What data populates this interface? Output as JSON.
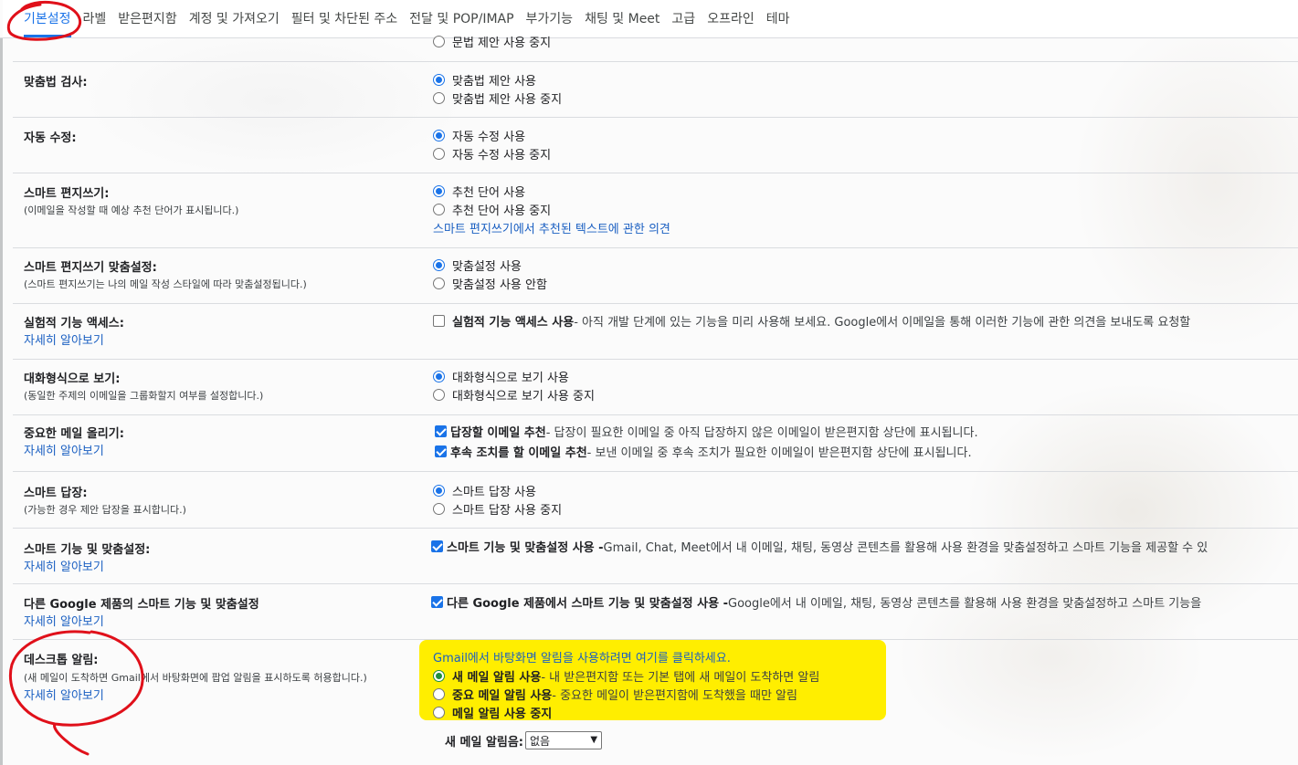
{
  "tabs": [
    "기본설정",
    "라벨",
    "받은편지함",
    "계정 및 가져오기",
    "필터 및 차단된 주소",
    "전달 및 POP/IMAP",
    "부가기능",
    "채팅 및 Meet",
    "고급",
    "오프라인",
    "테마"
  ],
  "top_partial": "문법 제안 사용 중지",
  "spelling": {
    "label": "맞춤법 검사:",
    "on": "맞춤법 제안 사용",
    "off": "맞춤법 제안 사용 중지"
  },
  "autocorrect": {
    "label": "자동 수정:",
    "on": "자동 수정 사용",
    "off": "자동 수정 사용 중지"
  },
  "smart_compose": {
    "label": "스마트 편지쓰기:",
    "sub": "(이메일을 작성할 때 예상 추천 단어가 표시됩니다.)",
    "on": "추천 단어 사용",
    "off": "추천 단어 사용 중지",
    "feedback": "스마트 편지쓰기에서 추천된 텍스트에 관한 의견"
  },
  "smart_compose_personal": {
    "label": "스마트 편지쓰기 맞춤설정:",
    "sub": "(스마트 편지쓰기는 나의 메일 작성 스타일에 따라 맞춤설정됩니다.)",
    "on": "맞춤설정 사용",
    "off": "맞춤설정 사용 안함"
  },
  "experimental": {
    "label": "실험적 기능 액세스:",
    "learn": "자세히 알아보기",
    "opt_bold": "실험적 기능 액세스 사용",
    "opt_desc": " - 아직 개발 단계에 있는 기능을 미리 사용해 보세요. Google에서 이메일을 통해 이러한 기능에 관한 의견을 보내도록 요청할"
  },
  "conversation": {
    "label": "대화형식으로 보기:",
    "sub": "(동일한 주제의 이메일을 그룹화할지 여부를 설정합니다.)",
    "on": "대화형식으로 보기 사용",
    "off": "대화형식으로 보기 사용 중지"
  },
  "nudges": {
    "label": "중요한 메일 올리기:",
    "learn": "자세히 알아보기",
    "opt1_bold": "답장할 이메일 추천",
    "opt1_desc": " - 답장이 필요한 이메일 중 아직 답장하지 않은 이메일이 받은편지함 상단에 표시됩니다.",
    "opt2_bold": "후속 조치를 할 이메일 추천",
    "opt2_desc": " - 보낸 이메일 중 후속 조치가 필요한 이메일이 받은편지함 상단에 표시됩니다."
  },
  "smart_reply": {
    "label": "스마트 답장:",
    "sub": "(가능한 경우 제안 답장을 표시합니다.)",
    "on": "스마트 답장 사용",
    "off": "스마트 답장 사용 중지"
  },
  "smart_features": {
    "label": "스마트 기능 및 맞춤설정:",
    "learn": "자세히 알아보기",
    "opt_bold": "스마트 기능 및 맞춤설정 사용 -",
    "opt_desc": " Gmail, Chat, Meet에서 내 이메일, 채팅, 동영상 콘텐츠를 활용해 사용 환경을 맞춤설정하고 스마트 기능을 제공할 수 있"
  },
  "other_products": {
    "label": "다른 Google 제품의 스마트 기능 및 맞춤설정",
    "learn": "자세히 알아보기",
    "opt_bold": "다른 Google 제품에서 스마트 기능 및 맞춤설정 사용 -",
    "opt_desc": " Google에서 내 이메일, 채팅, 동영상 콘텐츠를 활용해 사용 환경을 맞춤설정하고 스마트 기능을"
  },
  "desktop": {
    "label": "데스크톱 알림:",
    "sub": "(새 메일이 도착하면 Gmail에서 바탕화면에 팝업 알림을 표시하도록 허용합니다.)",
    "learn": "자세히 알아보기",
    "enable_link": "Gmail에서 바탕화면 알림을 사용하려면 여기를 클릭하세요.",
    "opt1_bold": "새 메일 알림 사용",
    "opt1_desc": " - 내 받은편지함 또는 기본 탭에 새 메일이 도착하면 알림",
    "opt2_bold": "중요 메일 알림 사용",
    "opt2_desc": " - 중요한 메일이 받은편지함에 도착했을 때만 알림",
    "opt3": "메일 알림 사용 중지",
    "sound_label": "새 메일 알림음:",
    "sound_value": "없음"
  },
  "colors": {
    "accent": "#1a73e8",
    "link": "#1a5fc2",
    "highlight": "#ffee00",
    "annotation": "#e0101a"
  }
}
